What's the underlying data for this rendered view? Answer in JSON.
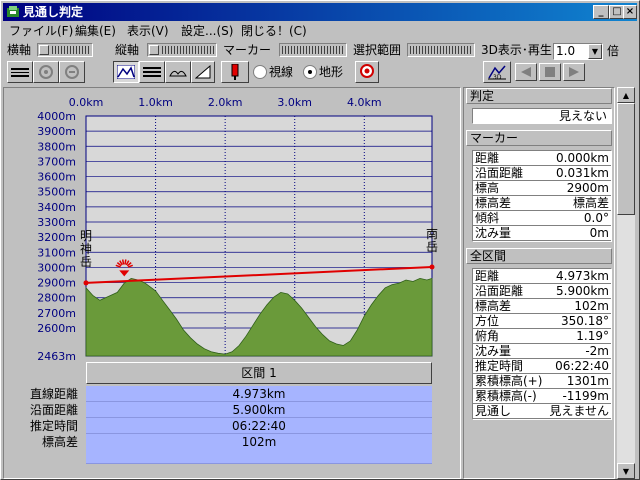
{
  "window": {
    "title": "見通し判定",
    "buttons": {
      "minimize": "_",
      "maximize": "□",
      "close": "×"
    }
  },
  "menu": [
    "ファイル(F)",
    "編集(E)",
    "表示(V)",
    "設定...(S)",
    "閉じる！(C)"
  ],
  "toolbar": {
    "horizontal_label": "横軸",
    "vertical_label": "縦軸",
    "marker_label": "マーカー",
    "range_label": "選択範囲",
    "view3d_label": "3D表示･再生",
    "speed_value": "1.0",
    "speed_unit": "倍",
    "radio_sight": "視線",
    "radio_terrain": "地形",
    "selected_radio": "地形"
  },
  "chart_data": {
    "type": "area",
    "x_tick_labels": [
      "0.0km",
      "1.0km",
      "2.0km",
      "3.0km",
      "4.0km"
    ],
    "y_tick_labels": [
      "4000m",
      "3900m",
      "3800m",
      "3700m",
      "3600m",
      "3500m",
      "3400m",
      "3300m",
      "3200m",
      "3100m",
      "3000m",
      "2900m",
      "2800m",
      "2700m",
      "2600m",
      "2463m"
    ],
    "ylim": [
      2463,
      4000
    ],
    "xlim": [
      0,
      4.973
    ],
    "terrain_profile": {
      "x": [
        0,
        0.1,
        0.2,
        0.3,
        0.45,
        0.55,
        0.65,
        0.75,
        0.85,
        1.0,
        1.1,
        1.2,
        1.3,
        1.4,
        1.5,
        1.6,
        1.7,
        1.8,
        1.9,
        2.0,
        2.1,
        2.2,
        2.3,
        2.4,
        2.5,
        2.6,
        2.7,
        2.8,
        2.9,
        3.0,
        3.1,
        3.2,
        3.3,
        3.4,
        3.5,
        3.6,
        3.7,
        3.8,
        3.9,
        4.0,
        4.1,
        4.2,
        4.3,
        4.4,
        4.5,
        4.6,
        4.7,
        4.8,
        4.9,
        4.973
      ],
      "y": [
        2900,
        2850,
        2820,
        2840,
        2870,
        2930,
        2960,
        2950,
        2930,
        2880,
        2820,
        2760,
        2700,
        2630,
        2580,
        2540,
        2510,
        2490,
        2480,
        2475,
        2490,
        2530,
        2590,
        2660,
        2730,
        2790,
        2840,
        2870,
        2860,
        2820,
        2770,
        2710,
        2650,
        2600,
        2560,
        2540,
        2530,
        2560,
        2630,
        2720,
        2790,
        2850,
        2900,
        2920,
        2930,
        2950,
        2940,
        2960,
        2950,
        2960
      ]
    },
    "sight_line": {
      "x": [
        0,
        4.973
      ],
      "y": [
        2931,
        3033
      ]
    },
    "start_label": "明神岳",
    "end_label": "南岳"
  },
  "judgement": {
    "header": "判定",
    "value": "見えない"
  },
  "marker": {
    "header": "マーカー",
    "rows": [
      {
        "k": "距離",
        "v": "0.000km"
      },
      {
        "k": "沿面距離",
        "v": "0.031km"
      },
      {
        "k": "標高",
        "v": "2900m"
      },
      {
        "k": "標高差",
        "v": "標高差"
      },
      {
        "k": "傾斜",
        "v": "0.0°"
      },
      {
        "k": "沈み量",
        "v": "0m"
      }
    ]
  },
  "full_range": {
    "header": "全区間",
    "rows": [
      {
        "k": "距離",
        "v": "4.973km"
      },
      {
        "k": "沿面距離",
        "v": "5.900km"
      },
      {
        "k": "標高差",
        "v": "102m"
      },
      {
        "k": "方位",
        "v": "350.18°"
      },
      {
        "k": "俯角",
        "v": "1.19°"
      },
      {
        "k": "沈み量",
        "v": "-2m"
      },
      {
        "k": "推定時間",
        "v": "06:22:40"
      },
      {
        "k": "累積標高(+)",
        "v": "1301m"
      },
      {
        "k": "累積標高(-)",
        "v": "-1199m"
      },
      {
        "k": "見通し",
        "v": "見えません"
      }
    ]
  },
  "section": {
    "title": "区間 1",
    "labels": [
      "直線距離",
      "沿面距離",
      "推定時間",
      "標高差"
    ],
    "values": [
      "4.973km",
      "5.900km",
      "06:22:40",
      "102m"
    ]
  }
}
